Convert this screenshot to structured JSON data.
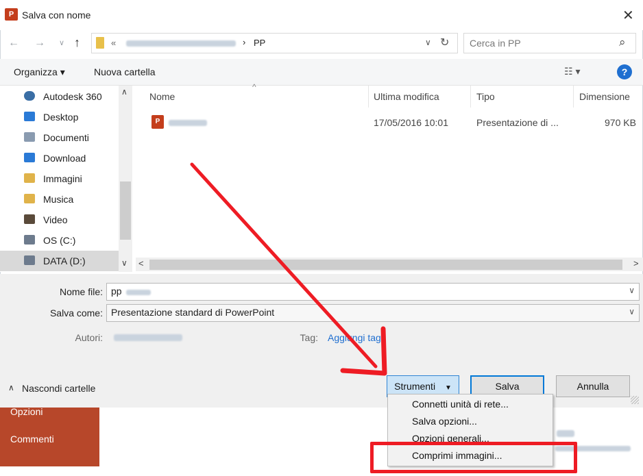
{
  "backstage": {
    "items": [
      "Opzioni",
      "Commenti"
    ]
  },
  "dialog": {
    "title": "Salva con nome",
    "close_glyph": "✕"
  },
  "address_bar": {
    "back_glyph": "←",
    "forward_glyph": "→",
    "history_glyph": "∨",
    "up_glyph": "↑",
    "overflow_glyph": "«",
    "separator_glyph": "›",
    "current_folder": "PP",
    "dropdown_glyph": "∨",
    "refresh_glyph": "↻"
  },
  "search": {
    "placeholder": "Cerca in PP",
    "icon_glyph": "⌕"
  },
  "toolbar": {
    "organize_label": "Organizza ▾",
    "new_folder_label": "Nuova cartella",
    "view_glyph": "☷ ▾",
    "help_glyph": "?"
  },
  "nav_pane": {
    "items": [
      {
        "label": "Autodesk 360",
        "icon": "cloud-icon",
        "color": "#3a6ea5"
      },
      {
        "label": "Desktop",
        "icon": "desktop-folder-icon",
        "color": "#2a7ad6"
      },
      {
        "label": "Documenti",
        "icon": "documents-icon",
        "color": "#8a9bb0"
      },
      {
        "label": "Download",
        "icon": "download-folder-icon",
        "color": "#2a7ad6"
      },
      {
        "label": "Immagini",
        "icon": "pictures-folder-icon",
        "color": "#e0b34a"
      },
      {
        "label": "Musica",
        "icon": "music-folder-icon",
        "color": "#e0b34a"
      },
      {
        "label": "Video",
        "icon": "video-folder-icon",
        "color": "#5a4a3a"
      },
      {
        "label": "OS (C:)",
        "icon": "os-drive-icon",
        "color": "#6d7b8d"
      },
      {
        "label": "DATA (D:)",
        "icon": "data-drive-icon",
        "color": "#6d7b8d"
      }
    ],
    "scroll_up_glyph": "∧",
    "scroll_down_glyph": "∨"
  },
  "file_list": {
    "columns": [
      "Nome",
      "Ultima modifica",
      "Tipo",
      "Dimensione"
    ],
    "sort_glyph": "^",
    "rows": [
      {
        "modified": "17/05/2016 10:01",
        "type": "Presentazione di ...",
        "size": "970 KB"
      }
    ],
    "hscroll_left_glyph": "<",
    "hscroll_right_glyph": ">"
  },
  "form": {
    "filename_label": "Nome file:",
    "filename_value": "pp",
    "savetype_label": "Salva come:",
    "savetype_value": "Presentazione standard di PowerPoint",
    "authors_label": "Autori:",
    "tags_label": "Tag:",
    "tags_placeholder": "Aggiungi tag",
    "dropdown_glyph": "∨"
  },
  "footer": {
    "hide_folders_label": "Nascondi cartelle",
    "hide_folders_glyph": "∧",
    "tools_label": "Strumenti",
    "tools_arrow": "▼",
    "save_label": "Salva",
    "cancel_label": "Annulla"
  },
  "tools_menu": {
    "items": [
      "Connetti unità di rete...",
      "Salva opzioni...",
      "Opzioni generali...",
      "Comprimi immagini..."
    ]
  },
  "colors": {
    "backstage_accent": "#b7472a",
    "annotation_red": "#ee1c24",
    "link_blue": "#1f6fd0"
  }
}
